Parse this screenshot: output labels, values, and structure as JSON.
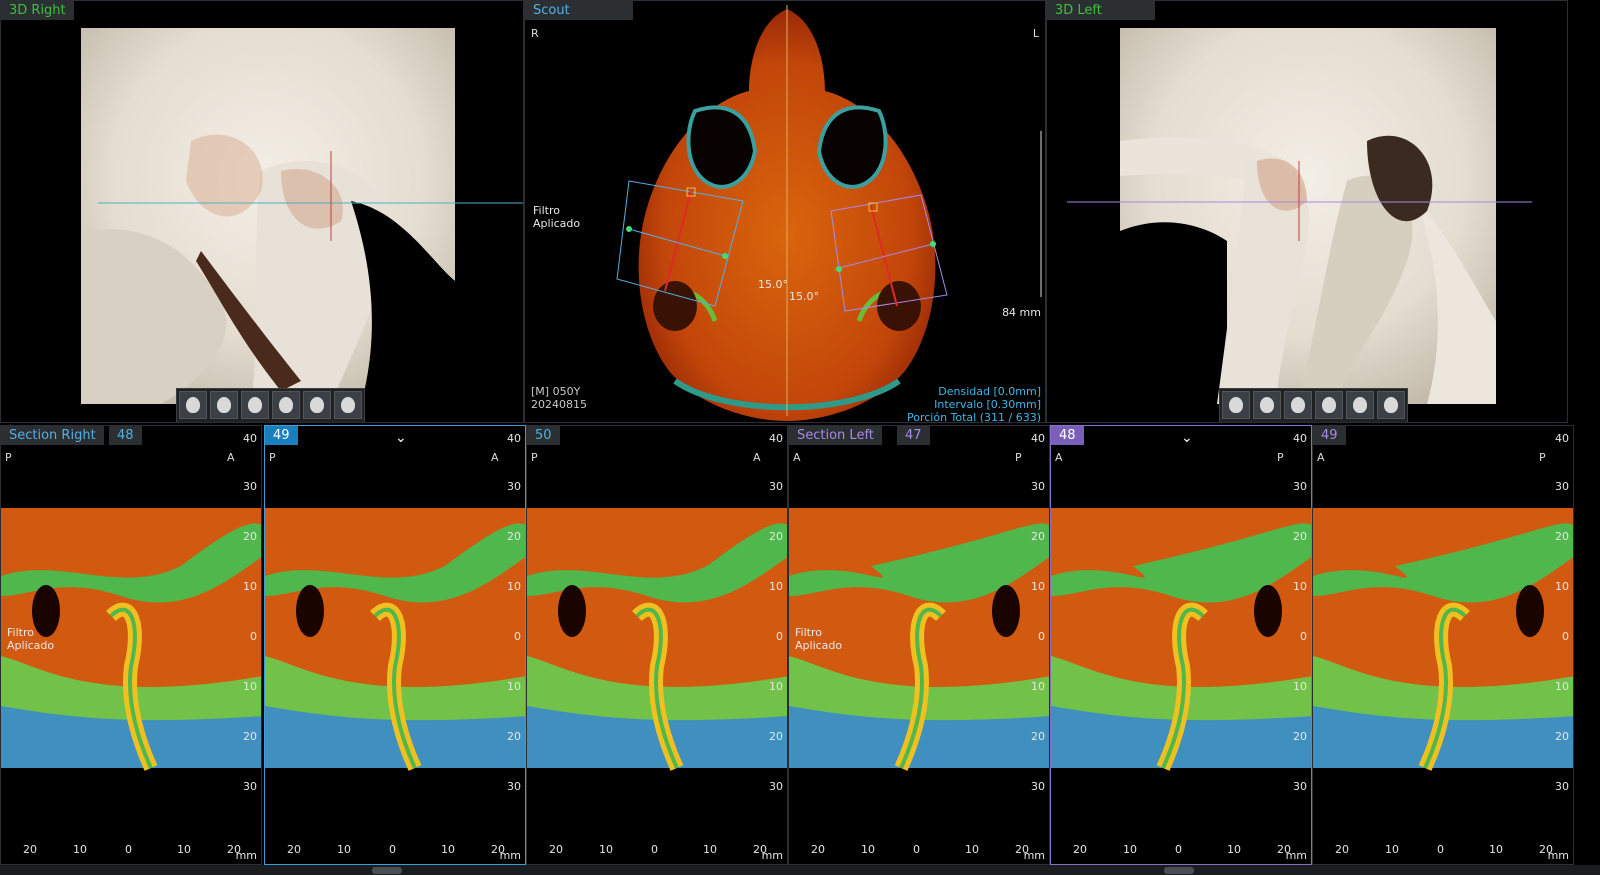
{
  "views": {
    "right3d": {
      "title": "3D Right"
    },
    "scout": {
      "title": "Scout",
      "orient_left": "R",
      "orient_right": "L",
      "filter_line1": "Filtro",
      "filter_line2": "Aplicado",
      "angle1": "15.0°",
      "angle2": "15.0°",
      "scale": "84 mm",
      "patient": "[M] 050Y",
      "date": "20240815",
      "density": "Densidad [0.0mm]",
      "interval": "Intervalo [0.30mm]",
      "portion": "Porción Total (311 / 633)"
    },
    "left3d": {
      "title": "3D Left"
    },
    "toolbar_icons": [
      "head-front-icon",
      "head-right-icon",
      "head-left-icon",
      "head-top-icon",
      "head-bottom-icon",
      "head-back-icon"
    ]
  },
  "sections": {
    "right": {
      "title": "Section Right"
    },
    "left": {
      "title": "Section Left"
    },
    "filter_line1": "Filtro",
    "filter_line2": "Aplicado",
    "chevron": "⌄",
    "unit": "mm",
    "rticks": [
      "40",
      "30",
      "20",
      "10",
      "0",
      "10",
      "20",
      "30"
    ],
    "bticks": [
      "20",
      "10",
      "0",
      "10",
      "20"
    ],
    "panels": [
      {
        "num": "48",
        "left": "P",
        "right": "A"
      },
      {
        "num": "49",
        "left": "P",
        "right": "A"
      },
      {
        "num": "50",
        "left": "P",
        "right": "A"
      },
      {
        "num": "47",
        "left": "A",
        "right": "P"
      },
      {
        "num": "48",
        "left": "A",
        "right": "P"
      },
      {
        "num": "49",
        "left": "A",
        "right": "P"
      }
    ]
  }
}
